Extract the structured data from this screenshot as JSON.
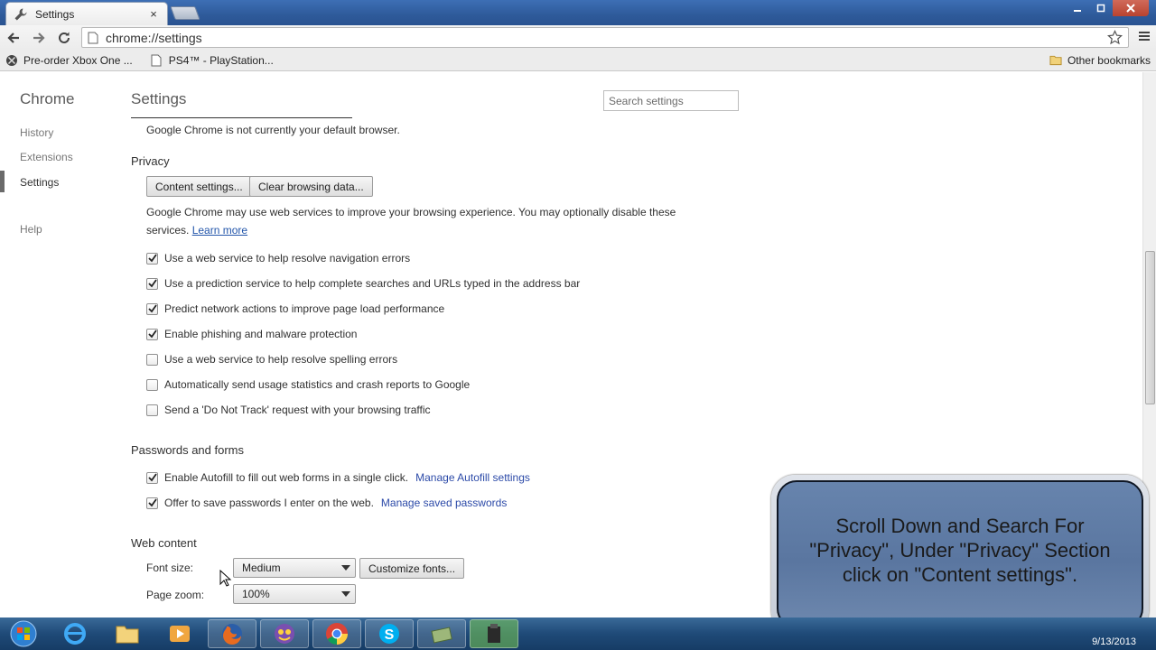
{
  "browser": {
    "tab_title": "Settings",
    "tab_close": "×",
    "url": "chrome://settings",
    "bookmarks": [
      "Pre-order Xbox One ...",
      "PS4™ - PlayStation..."
    ],
    "other_bookmarks": "Other bookmarks"
  },
  "sidebar": {
    "title": "Chrome",
    "items": [
      {
        "label": "History"
      },
      {
        "label": "Extensions"
      },
      {
        "label": "Settings"
      },
      {
        "label": "Help"
      }
    ]
  },
  "main": {
    "title": "Settings",
    "search_placeholder": "Search settings",
    "default_browser_text": "Google Chrome is not currently your default browser.",
    "privacy": {
      "heading": "Privacy",
      "content_settings_button": "Content settings...",
      "clear_browsing_button": "Clear browsing data...",
      "description_line1": "Google Chrome may use web services to improve your browsing experience. You may optionally disable these",
      "description_line2": "services.",
      "learn_more": "Learn more",
      "options": [
        {
          "label": "Use a web service to help resolve navigation errors",
          "checked": true
        },
        {
          "label": "Use a prediction service to help complete searches and URLs typed in the address bar",
          "checked": true
        },
        {
          "label": "Predict network actions to improve page load performance",
          "checked": true
        },
        {
          "label": "Enable phishing and malware protection",
          "checked": true
        },
        {
          "label": "Use a web service to help resolve spelling errors",
          "checked": false
        },
        {
          "label": "Automatically send usage statistics and crash reports to Google",
          "checked": false
        },
        {
          "label": "Send a 'Do Not Track' request with your browsing traffic",
          "checked": false
        }
      ]
    },
    "passwords": {
      "heading": "Passwords and forms",
      "autofill_label": "Enable Autofill to fill out web forms in a single click.",
      "autofill_link": "Manage Autofill settings",
      "autofill_checked": true,
      "save_pw_label": "Offer to save passwords I enter on the web.",
      "save_pw_link": "Manage saved passwords",
      "save_pw_checked": true
    },
    "web_content": {
      "heading": "Web content",
      "font_size_label": "Font size:",
      "font_size_value": "Medium",
      "customize_fonts_button": "Customize fonts...",
      "page_zoom_label": "Page zoom:",
      "page_zoom_value": "100%"
    }
  },
  "overlay": {
    "line1": "Scroll Down and Search For",
    "line2": "\"Privacy\", Under \"Privacy\" Section",
    "line3": "click on \"Content settings\"."
  },
  "taskbar": {
    "date": "9/13/2013"
  },
  "colors": {
    "link": "#2255aa",
    "overlay_bg": "#6784ad",
    "taskbar": "#1f4a78"
  }
}
